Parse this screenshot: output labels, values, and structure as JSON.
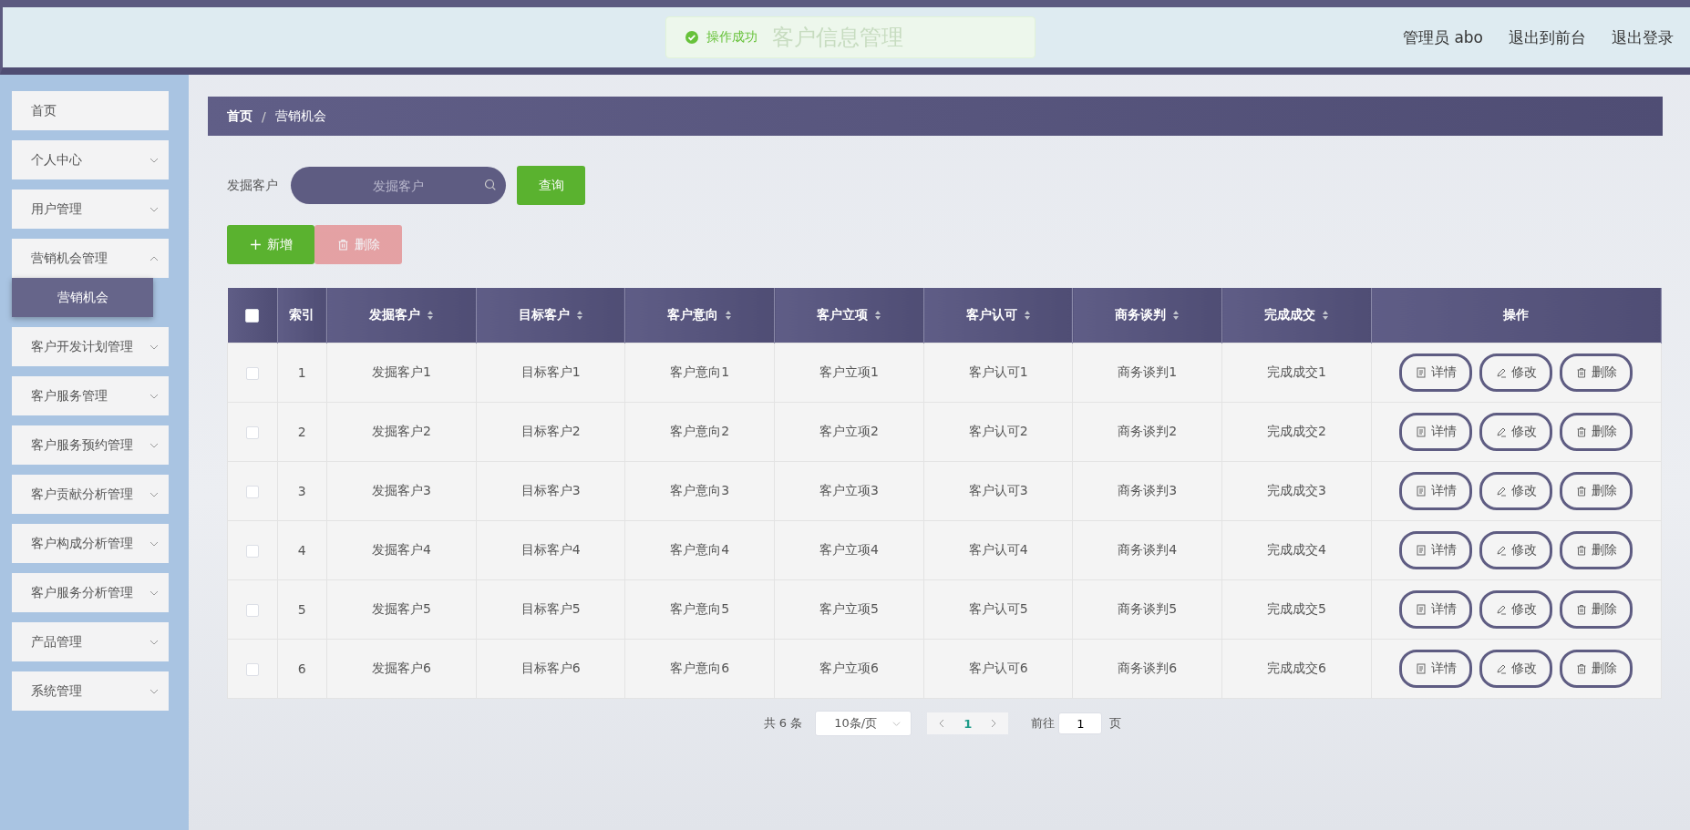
{
  "header": {
    "title": "客户信息管理",
    "toast": {
      "message": "操作成功"
    },
    "links": [
      "管理员 abo",
      "退出到前台",
      "退出登录"
    ]
  },
  "sidebar": {
    "items": [
      {
        "label": "首页",
        "kind": "link"
      },
      {
        "label": "个人中心",
        "kind": "submenu",
        "expanded": false
      },
      {
        "label": "用户管理",
        "kind": "submenu",
        "expanded": false
      },
      {
        "label": "营销机会管理",
        "kind": "submenu",
        "expanded": true,
        "children": [
          {
            "label": "营销机会",
            "selected": true
          }
        ]
      },
      {
        "label": "客户开发计划管理",
        "kind": "submenu",
        "expanded": false
      },
      {
        "label": "客户服务管理",
        "kind": "submenu",
        "expanded": false
      },
      {
        "label": "客户服务预约管理",
        "kind": "submenu",
        "expanded": false
      },
      {
        "label": "客户贡献分析管理",
        "kind": "submenu",
        "expanded": false
      },
      {
        "label": "客户构成分析管理",
        "kind": "submenu",
        "expanded": false
      },
      {
        "label": "客户服务分析管理",
        "kind": "submenu",
        "expanded": false
      },
      {
        "label": "产品管理",
        "kind": "submenu",
        "expanded": false
      },
      {
        "label": "系统管理",
        "kind": "submenu",
        "expanded": false
      }
    ]
  },
  "breadcrumb": {
    "items": [
      "首页",
      "营销机会"
    ],
    "separator": "/"
  },
  "search": {
    "label": "发掘客户",
    "placeholder": "发掘客户",
    "button": "查询"
  },
  "actions": [
    {
      "label": "新增",
      "kind": "add",
      "disabled": false
    },
    {
      "label": "删除",
      "kind": "delete",
      "disabled": true
    }
  ],
  "table": {
    "header_checked": false,
    "columns": [
      {
        "label": "索引",
        "sortable": false
      },
      {
        "label": "发掘客户",
        "sortable": true
      },
      {
        "label": "目标客户",
        "sortable": true
      },
      {
        "label": "客户意向",
        "sortable": true
      },
      {
        "label": "客户立项",
        "sortable": true
      },
      {
        "label": "客户认可",
        "sortable": true
      },
      {
        "label": "商务谈判",
        "sortable": true
      },
      {
        "label": "完成成交",
        "sortable": true
      },
      {
        "label": "操作",
        "sortable": false
      }
    ],
    "rows": [
      {
        "checked": false,
        "cells": [
          "1",
          "发掘客户1",
          "目标客户1",
          "客户意向1",
          "客户立项1",
          "客户认可1",
          "商务谈判1",
          "完成成交1"
        ],
        "buttons": [
          {
            "label": "详情",
            "kind": "detail"
          },
          {
            "label": "修改",
            "kind": "edit"
          },
          {
            "label": "删除",
            "kind": "delete"
          }
        ]
      },
      {
        "checked": false,
        "cells": [
          "2",
          "发掘客户2",
          "目标客户2",
          "客户意向2",
          "客户立项2",
          "客户认可2",
          "商务谈判2",
          "完成成交2"
        ],
        "buttons": [
          {
            "label": "详情",
            "kind": "detail"
          },
          {
            "label": "修改",
            "kind": "edit"
          },
          {
            "label": "删除",
            "kind": "delete"
          }
        ]
      },
      {
        "checked": false,
        "cells": [
          "3",
          "发掘客户3",
          "目标客户3",
          "客户意向3",
          "客户立项3",
          "客户认可3",
          "商务谈判3",
          "完成成交3"
        ],
        "buttons": [
          {
            "label": "详情",
            "kind": "detail"
          },
          {
            "label": "修改",
            "kind": "edit"
          },
          {
            "label": "删除",
            "kind": "delete"
          }
        ]
      },
      {
        "checked": false,
        "cells": [
          "4",
          "发掘客户4",
          "目标客户4",
          "客户意向4",
          "客户立项4",
          "客户认可4",
          "商务谈判4",
          "完成成交4"
        ],
        "buttons": [
          {
            "label": "详情",
            "kind": "detail"
          },
          {
            "label": "修改",
            "kind": "edit"
          },
          {
            "label": "删除",
            "kind": "delete"
          }
        ]
      },
      {
        "checked": false,
        "cells": [
          "5",
          "发掘客户5",
          "目标客户5",
          "客户意向5",
          "客户立项5",
          "客户认可5",
          "商务谈判5",
          "完成成交5"
        ],
        "buttons": [
          {
            "label": "详情",
            "kind": "detail"
          },
          {
            "label": "修改",
            "kind": "edit"
          },
          {
            "label": "删除",
            "kind": "delete"
          }
        ]
      },
      {
        "checked": false,
        "cells": [
          "6",
          "发掘客户6",
          "目标客户6",
          "客户意向6",
          "客户立项6",
          "客户认可6",
          "商务谈判6",
          "完成成交6"
        ],
        "buttons": [
          {
            "label": "详情",
            "kind": "detail"
          },
          {
            "label": "修改",
            "kind": "edit"
          },
          {
            "label": "删除",
            "kind": "delete"
          }
        ]
      }
    ]
  },
  "pagination": {
    "total": "共 6 条",
    "page_size": "10条/页",
    "pages": [
      {
        "label": "1",
        "selected": true
      }
    ],
    "goto_label": "前往",
    "goto_value": "1",
    "goto_unit": "页"
  }
}
